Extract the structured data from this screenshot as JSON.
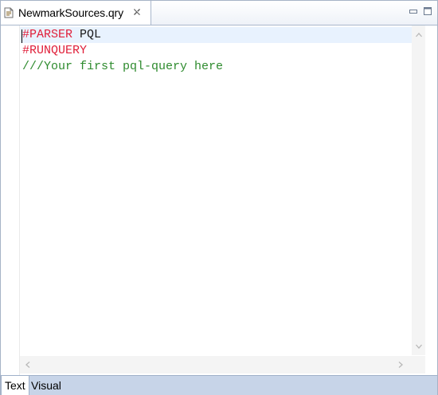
{
  "editor": {
    "tab": {
      "title": "NewmarkSources.qry",
      "file_icon": "query-file-icon",
      "close_icon": "close-icon"
    },
    "window_controls": {
      "minimize_icon": "minimize-icon",
      "maximize_icon": "maximize-icon"
    },
    "lines": [
      {
        "tokens": [
          {
            "text": "#PARSER",
            "kind": "directive"
          },
          {
            "text": " PQL",
            "kind": "plain"
          }
        ],
        "current": true
      },
      {
        "tokens": [
          {
            "text": "#RUNQUERY",
            "kind": "directive"
          }
        ],
        "current": false
      },
      {
        "tokens": [
          {
            "text": "///Your first pql-query here",
            "kind": "comment"
          }
        ],
        "current": false
      }
    ],
    "colors": {
      "directive": "#e0203a",
      "comment": "#2e8b2e",
      "current_line": "#e8f2fe",
      "page_tab_bar": "#c7d4e8"
    }
  },
  "page_tabs": [
    {
      "label": "Text",
      "active": true
    },
    {
      "label": "Visual",
      "active": false
    }
  ]
}
